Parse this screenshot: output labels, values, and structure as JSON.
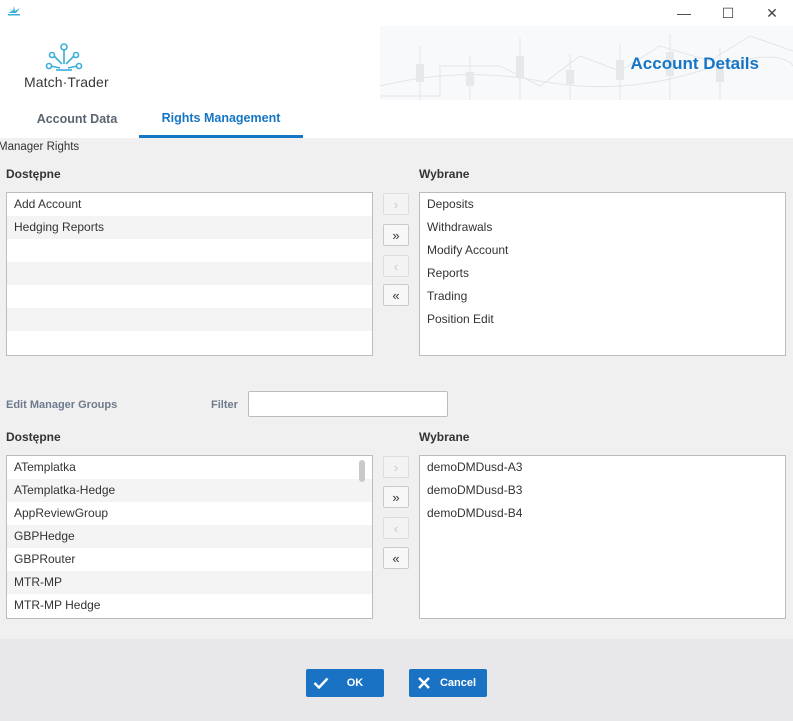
{
  "window": {
    "minimize_glyph": "—",
    "maximize_glyph": "☐",
    "close_glyph": "✕"
  },
  "header": {
    "logo_text": "Match·Trader",
    "title": "Account Details"
  },
  "tabs": [
    {
      "label": "Account Data",
      "active": false
    },
    {
      "label": "Rights Management",
      "active": true
    }
  ],
  "rights": {
    "section_caption": "Manager Rights",
    "available_label": "Dostępne",
    "selected_label": "Wybrane",
    "available_items": [
      "Add Account",
      "Hedging Reports",
      "",
      "",
      "",
      "",
      ""
    ],
    "selected_items": [
      "Deposits",
      "Withdrawals",
      "Modify Account",
      "Reports",
      "Trading",
      "Position Edit"
    ]
  },
  "groups": {
    "edit_label": "Edit Manager Groups",
    "filter_label": "Filter",
    "filter_value": "",
    "available_label": "Dostępne",
    "selected_label": "Wybrane",
    "available_items": [
      "ATemplatka",
      "ATemplatka-Hedge",
      "AppReviewGroup",
      "GBPHedge",
      "GBPRouter",
      "MTR-MP",
      "MTR-MP Hedge"
    ],
    "selected_items": [
      "demoDMDusd-A3",
      "demoDMDusd-B3",
      "demoDMDusd-B4"
    ]
  },
  "mover_buttons": {
    "add_one": "›",
    "add_all": "»",
    "remove_one": "‹",
    "remove_all": "«"
  },
  "footer": {
    "ok_label": "OK",
    "cancel_label": "Cancel"
  },
  "colors": {
    "accent": "#1576c5",
    "button": "#1a72c4",
    "content_bg": "#f0f0f1",
    "footer_bg": "#e8e8ea"
  }
}
